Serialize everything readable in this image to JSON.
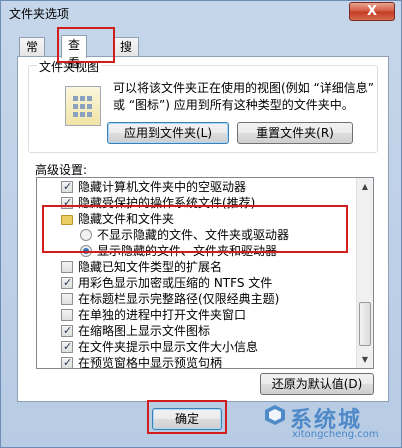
{
  "window": {
    "title": "文件夹选项",
    "close_label": "X"
  },
  "tabs": [
    {
      "label": "常规"
    },
    {
      "label": "查看"
    },
    {
      "label": "搜索"
    }
  ],
  "folder_views": {
    "title": "文件夹视图",
    "description": "可以将该文件夹正在使用的视图(例如 “详细信息” 或 “图标”) 应用到所有这种类型的文件夹中。",
    "apply_button": "应用到文件夹(L)",
    "reset_button": "重置文件夹(R)"
  },
  "advanced": {
    "label": "高级设置:",
    "items": [
      {
        "type": "checkbox",
        "checked": true,
        "label": "隐藏计算机文件夹中的空驱动器"
      },
      {
        "type": "checkbox",
        "checked": true,
        "label": "隐藏受保护的操作系统文件(推荐)"
      },
      {
        "type": "folder",
        "label": "隐藏文件和文件夹"
      },
      {
        "type": "radio",
        "checked": false,
        "label": "不显示隐藏的文件、文件夹或驱动器"
      },
      {
        "type": "radio",
        "checked": true,
        "label": "显示隐藏的文件、文件夹和驱动器"
      },
      {
        "type": "checkbox",
        "checked": false,
        "label": "隐藏已知文件类型的扩展名"
      },
      {
        "type": "checkbox",
        "checked": true,
        "label": "用彩色显示加密或压缩的 NTFS 文件"
      },
      {
        "type": "checkbox",
        "checked": false,
        "label": "在标题栏显示完整路径(仅限经典主题)"
      },
      {
        "type": "checkbox",
        "checked": false,
        "label": "在单独的进程中打开文件夹窗口"
      },
      {
        "type": "checkbox",
        "checked": true,
        "label": "在缩略图上显示文件图标"
      },
      {
        "type": "checkbox",
        "checked": true,
        "label": "在文件夹提示中显示文件大小信息"
      },
      {
        "type": "checkbox",
        "checked": true,
        "label": "在预览窗格中显示预览句柄"
      }
    ],
    "restore_button": "还原为默认值(D)"
  },
  "footer": {
    "ok_button": "确定"
  },
  "watermark": {
    "text": "系统城",
    "url": "xitongcheng.com"
  },
  "colors": {
    "highlight": "#d21d1d",
    "accent": "#3d7fc4"
  }
}
